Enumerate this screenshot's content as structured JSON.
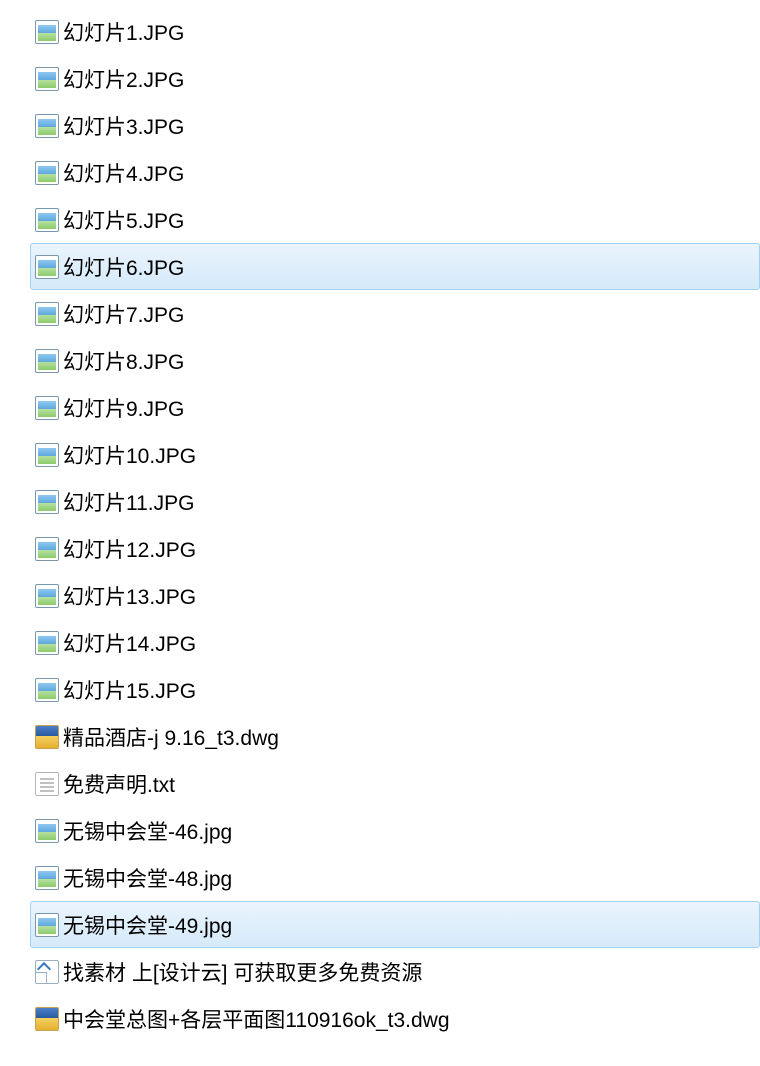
{
  "files": [
    {
      "name": "幻灯片1.JPG",
      "iconType": "image",
      "selected": false
    },
    {
      "name": "幻灯片2.JPG",
      "iconType": "image",
      "selected": false
    },
    {
      "name": "幻灯片3.JPG",
      "iconType": "image",
      "selected": false
    },
    {
      "name": "幻灯片4.JPG",
      "iconType": "image",
      "selected": false
    },
    {
      "name": "幻灯片5.JPG",
      "iconType": "image",
      "selected": false
    },
    {
      "name": "幻灯片6.JPG",
      "iconType": "image",
      "selected": true
    },
    {
      "name": "幻灯片7.JPG",
      "iconType": "image",
      "selected": false
    },
    {
      "name": "幻灯片8.JPG",
      "iconType": "image",
      "selected": false
    },
    {
      "name": "幻灯片9.JPG",
      "iconType": "image",
      "selected": false
    },
    {
      "name": "幻灯片10.JPG",
      "iconType": "image",
      "selected": false
    },
    {
      "name": "幻灯片11.JPG",
      "iconType": "image",
      "selected": false
    },
    {
      "name": "幻灯片12.JPG",
      "iconType": "image",
      "selected": false
    },
    {
      "name": "幻灯片13.JPG",
      "iconType": "image",
      "selected": false
    },
    {
      "name": "幻灯片14.JPG",
      "iconType": "image",
      "selected": false
    },
    {
      "name": "幻灯片15.JPG",
      "iconType": "image",
      "selected": false
    },
    {
      "name": "精品酒店-j 9.16_t3.dwg",
      "iconType": "dwg",
      "selected": false
    },
    {
      "name": "免费声明.txt",
      "iconType": "txt",
      "selected": false
    },
    {
      "name": "无锡中会堂-46.jpg",
      "iconType": "image",
      "selected": false
    },
    {
      "name": "无锡中会堂-48.jpg",
      "iconType": "image",
      "selected": false
    },
    {
      "name": "无锡中会堂-49.jpg",
      "iconType": "image",
      "selected": true
    },
    {
      "name": "找素材 上[设计云]  可获取更多免费资源",
      "iconType": "url",
      "selected": false
    },
    {
      "name": "中会堂总图+各层平面图110916ok_t3.dwg",
      "iconType": "dwg",
      "selected": false
    }
  ]
}
